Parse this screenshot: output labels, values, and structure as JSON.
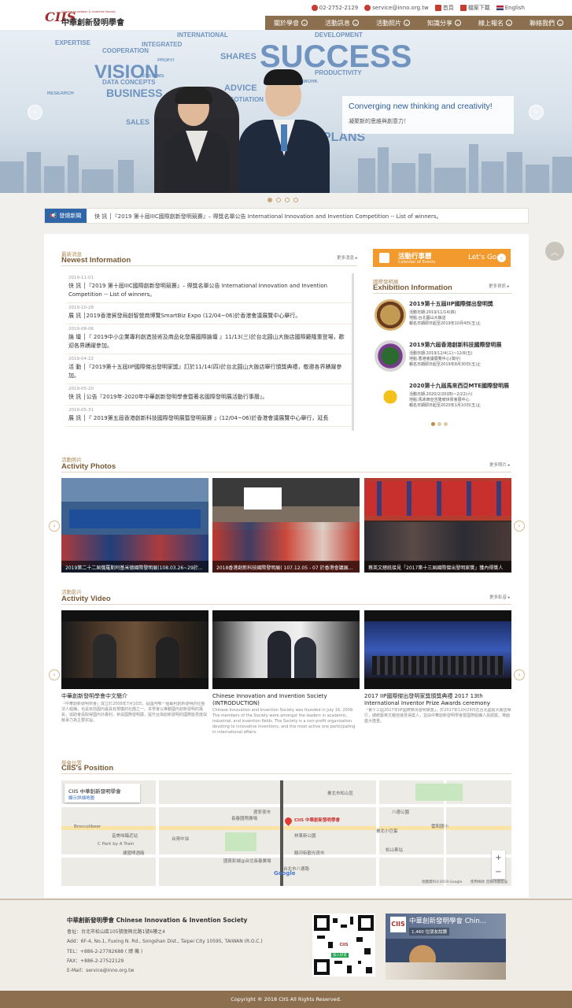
{
  "header": {
    "logo_mark": "CIIS",
    "logo_tagline": "Chinese Innovation & Invention Society",
    "logo_name": "中華創新發明學會",
    "phone": "02-2752-2129",
    "email": "service@inno.org.tw",
    "home": "首頁",
    "download": "檔案下載",
    "english": "English",
    "nav": [
      "關於學會",
      "活動訊息",
      "活動照片",
      "知識分享",
      "線上報名",
      "聯絡我們"
    ]
  },
  "hero": {
    "slogan_en": "Converging new thinking and creativity!",
    "slogan_zh": "凝聚新的思維與創意力！",
    "words": [
      "SUCCESS",
      "VISION",
      "BUSINESS",
      "SHARES",
      "EXPERTISE",
      "DATA CONCEPTS",
      "PLANS",
      "ADVICE",
      "INTERNATIONAL",
      "DEVELOPMENT",
      "COOPERATION",
      "INTEGRATED",
      "NEGOTIATION",
      "TEAMWORK",
      "PRODUCTIVITY",
      "SALES",
      "PROFIT",
      "SYSTEMS",
      "RESEARCH"
    ]
  },
  "ticker": {
    "label": "發燒新聞",
    "text": "快 訊 │『2019 第十屆IIIC國際創新發明競賽』– 得獎名單公告 International Innovation and Invention Competition -- List of winners。"
  },
  "news": {
    "small": "最新消息",
    "title": "Newest Information",
    "more": "更多消息 ▸",
    "items": [
      {
        "date": "2019-11-01",
        "text": "快 訊 │『2019 第十屆IIIC國際創新發明競賽』– 得獎名單公告 International Innovation and Invention Competition -- List of winners。"
      },
      {
        "date": "2019-10-28",
        "text": "展 訊 │2019香港貿發局創智營商博覽SmartBiz Expo (12/04~06)於香港會議展覽中心舉行。"
      },
      {
        "date": "2019-08-06",
        "text": "論 壇 │『 2019中小企業專利創造技術及商品化發展國際論壇 』11/13(三)於台北圓山大飯店國際廳隆重登場，歡迎各界踴躍參加。"
      },
      {
        "date": "2019-04-22",
        "text": "活 動 │『2019第十五屆IIP國際傑出發明家獎』訂於11/14(四)於台北圓山大飯店舉行頒獎典禮，敬邀各界踴躍參加。"
      },
      {
        "date": "2019-05-20",
        "text": "快 訊 │公告『2019年-2020年中華創新發明學會暨著名國際發明展活動行事曆』。"
      },
      {
        "date": "2019-05-31",
        "text": "展 訊 │『 2019第五屆香港創新科技國際發明展暨發明競賽 』(12/04~06)於香港會議展覽中心舉行，延長"
      }
    ]
  },
  "calendar": {
    "zh": "活動行事曆",
    "en": "Calendar of Events",
    "go": "Let's Go"
  },
  "exhibition": {
    "small": "國際發明展",
    "title": "Exhibition Information",
    "more": "更多資訊 ▸",
    "items": [
      {
        "name": "2019第十五屆IIP國際傑出發明獎",
        "l1": "活動日期:2019/11/14(四)",
        "l2": "地點:台北圓山大飯店",
        "l3": "報名日期即日起至2019年10月4日(五)止"
      },
      {
        "name": "2019第六屆香港創新科技國際發明展",
        "l1": "活動日期:2019/12/4(三)~12/6(五)",
        "l2": "地點:香港會議展覽中心(灣仔)",
        "l3": "報名日期即日起至2019年8月30日(五)止"
      },
      {
        "name": "2020第十九屆馬來西亞MTE國際發明展",
        "l1": "活動日期:2020/2/20(四)~2/22(六)",
        "l2": "地點:馬來西亞吉隆坡世貿會展中心",
        "l3": "報名日期即日起至2020年1月10日(五)止"
      }
    ]
  },
  "photos": {
    "small": "活動照片",
    "title": "Activity Photos",
    "more": "更多照片 ▸",
    "items": [
      {
        "caption": "2019第二十二屆俄羅斯阿基米德國際發明展(108.03.26~29於..."
      },
      {
        "caption": "2018香港創新科技國際發明展( 107.12.05 - 07 於香港會議展..."
      },
      {
        "caption": "蔡英文總統接見「2017第十三屆國際傑出發明家獎」獲內得獎人"
      }
    ]
  },
  "videos": {
    "small": "活動影片",
    "title": "Activity Video",
    "more": "更多影音 ▸",
    "items": [
      {
        "title": "中華創新發明學會中文簡介",
        "desc": "「中華創新發明學會」成立於2009年7月16日，是國內唯一個專利創新發明的社團法人組織，也是目前國內最具有規模的社團之一。本學會以推動國內創新發明的風氣，協助會員取得國內外專利，參與國際發明展，提升台灣創新發明的國際能見度與競爭力為主要宗旨。"
      },
      {
        "title": "Chinese Innovation and Invention Society (INTRODUCTION)",
        "desc": "Chinese Innovation and Invention Society was founded in July 16, 2009. The members of the Society were amongst the leaders in academic, industrial, and invention fields. The Society is a non-profit organization devoting to innovative inventions, and the most active one participating in international affairs."
      },
      {
        "title": "2017 IIP國際傑出發明家獎頒獎典禮 2017 13th International Inventor Prize Awards ceremony",
        "desc": "「第十三屆2017年IIP國際傑出發明家獎」，於2017年12月29日在台北國賓大飯店舉行，總統蔡英文親自接見得獎人，並由中華創新發明學會暨國際組織人員頒獎，場面盛大隆重。"
      }
    ]
  },
  "map": {
    "small": "學會位置",
    "title": "CIIS's Position",
    "card_title": "CIIS 中華創新發明學會",
    "card_link": "顯示詳細地圖",
    "pin_label": "CIIS 中華創新發明學會",
    "labels": [
      "臺北市松山區",
      "遼寧夜市",
      "八德公園",
      "松山車站",
      "臺北小巨蛋",
      "Broccolibeer",
      "音美味臨近站",
      "C Park by A Train",
      "建國啤酒廠",
      "林東新公園",
      "饒河街觀光夜市",
      "台灣中油",
      "國賓影城@台北長春廣場",
      "雲和國小",
      "長春國際廣場",
      "Google",
      "地圖資料©2019 Google",
      "使用條款",
      "回報地圖錯誤",
      "台北市八德路"
    ]
  },
  "footer": {
    "org": "中華創新發明學會 Chinese Innovation & Invention Society",
    "addr_zh": "會址：台北市松山區105號復興北路1號6樓之4",
    "addr_en": "Add：6F-4, No.1, Fuxing N. Rd., Songshan Dist., Taipei City 10595, TAIWAN (R.O.C.)",
    "tel": "TEL：+886-2-27782688 ( 總 機 )",
    "fax": "FAX：+886-2-27522129",
    "email": "E-Mail：service@inno.org.tw",
    "fb_title": "中華創新發明學會 Chin...",
    "fb_likes": "1,460 位朋友說讚",
    "qr_label": "加入好友"
  },
  "copyright": "Copyright ® 2018 CIIS All Rights Reserved.",
  "colors": {
    "brand_brown": "#8c6f4e",
    "accent_orange": "#f29a2e",
    "ticker_blue": "#2f66a8"
  }
}
